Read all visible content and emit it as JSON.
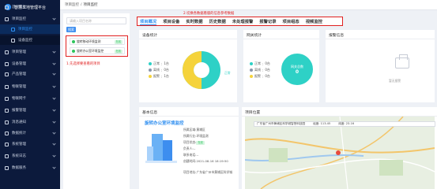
{
  "sidebar": {
    "logo_text": "智慧工地管理平台",
    "items": [
      {
        "label": "首页看板",
        "top": 0
      },
      {
        "label": "项目监控"
      },
      {
        "label": "项目监控",
        "sub": true,
        "active": true
      },
      {
        "label": "设备监控",
        "sub": true
      },
      {
        "label": "项目管理"
      },
      {
        "label": "设备管理"
      },
      {
        "label": "产品管理"
      },
      {
        "label": "物联管理"
      },
      {
        "label": "物联网卡"
      },
      {
        "label": "报警管理"
      },
      {
        "label": "消息通知"
      },
      {
        "label": "数据统计"
      },
      {
        "label": "系统管理"
      },
      {
        "label": "系统日志"
      },
      {
        "label": "数据服务"
      }
    ]
  },
  "breadcrumb": {
    "parent": "项目监控",
    "separator": "/",
    "current": "项目监控"
  },
  "project_panel": {
    "search_placeholder": "请输入项目名称",
    "search_button": "搜索",
    "projects": [
      {
        "name": "旋转移动环境监测",
        "status": "在线"
      },
      {
        "name": "旋转办公室环境监控",
        "status": "在线"
      }
    ]
  },
  "notes": {
    "select_project": "1.先选择要查看的项目",
    "switch_tabs": "2.切换各数据看版的信息参考数据"
  },
  "tabs": [
    "项目概况",
    "项目设备",
    "实时数据",
    "历史数据",
    "未处理报警",
    "报警记录",
    "项目组态",
    "视频监控"
  ],
  "device_stats": {
    "title": "设备统计",
    "legend": [
      {
        "label": "正常",
        "value": "1台",
        "color": "#2ed1c6"
      },
      {
        "label": "离线",
        "value": "0台",
        "color": "#8a95ab"
      },
      {
        "label": "报警",
        "value": "1台",
        "color": "#f5d33b"
      }
    ],
    "center_label": "正常",
    "pie": [
      {
        "label": "正常",
        "value": 1,
        "color": "#2ed1c6"
      },
      {
        "label": "报警",
        "value": 1,
        "color": "#f5d33b"
      }
    ]
  },
  "gateway_stats": {
    "title": "网关统计",
    "legend": [
      {
        "label": "正常",
        "value": "0台",
        "color": "#2ed1c6"
      },
      {
        "label": "离线",
        "value": "0台",
        "color": "#8a95ab"
      },
      {
        "label": "报警",
        "value": "0台",
        "color": "#f5d33b"
      }
    ],
    "center_title": "网关总数",
    "center_value": "0"
  },
  "alarm_info": {
    "title": "报警信息",
    "empty": "暂无报警"
  },
  "basic_info": {
    "title": "基本信息",
    "project_name": "旋转办公室环境监控",
    "rows": [
      {
        "label": "所属区域:",
        "value": "黄埔区"
      },
      {
        "label": "所属行业:",
        "value": "环境监测"
      },
      {
        "label": "项目状态:",
        "value": "在线",
        "badge": true
      },
      {
        "label": "负责人:",
        "value": "--"
      },
      {
        "label": "联系电话:",
        "value": "--"
      },
      {
        "label": "创建时间:",
        "value": "2021-08-16 18:19:50"
      },
      {
        "label": "项目地址:",
        "value": "广东省广州市黄埔区科学城"
      }
    ]
  },
  "project_location": {
    "title": "项目位置",
    "address": "广东省广州市黄埔区科学城智慧科技园",
    "lng_label": "经度: 113.45",
    "lat_label": "纬度: 23.16"
  }
}
